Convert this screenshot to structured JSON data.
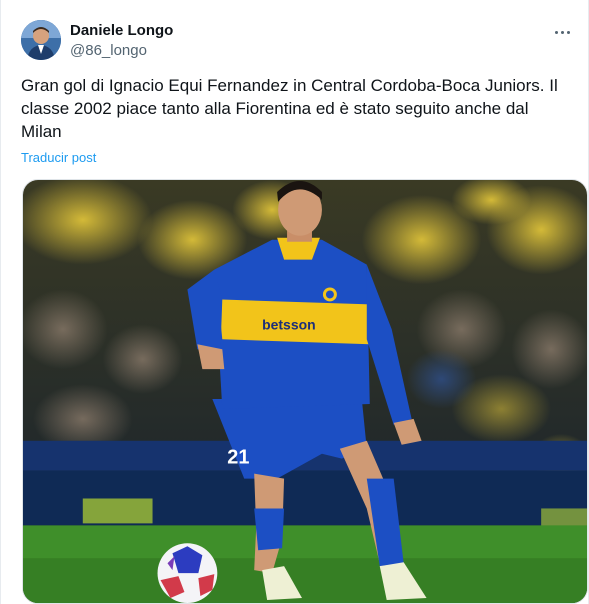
{
  "tweet": {
    "author": {
      "name": "Daniele Longo",
      "handle": "@86_longo"
    },
    "text": "Gran gol di Ignacio Equi Fernandez in Central Cordoba-Boca Juniors. Il classe 2002 piace tanto alla Fiorentina ed è stato seguito anche dal Milan",
    "translate_label": "Traducir post",
    "media": {
      "jersey_sponsor": "betsson",
      "jersey_number": "21",
      "colors": {
        "jersey_blue": "#1c4fc4",
        "stripe_yellow": "#f2c41a",
        "pitch_green": "#3f8f2a"
      }
    }
  },
  "icons": {
    "more": "more-horizontal-icon"
  }
}
